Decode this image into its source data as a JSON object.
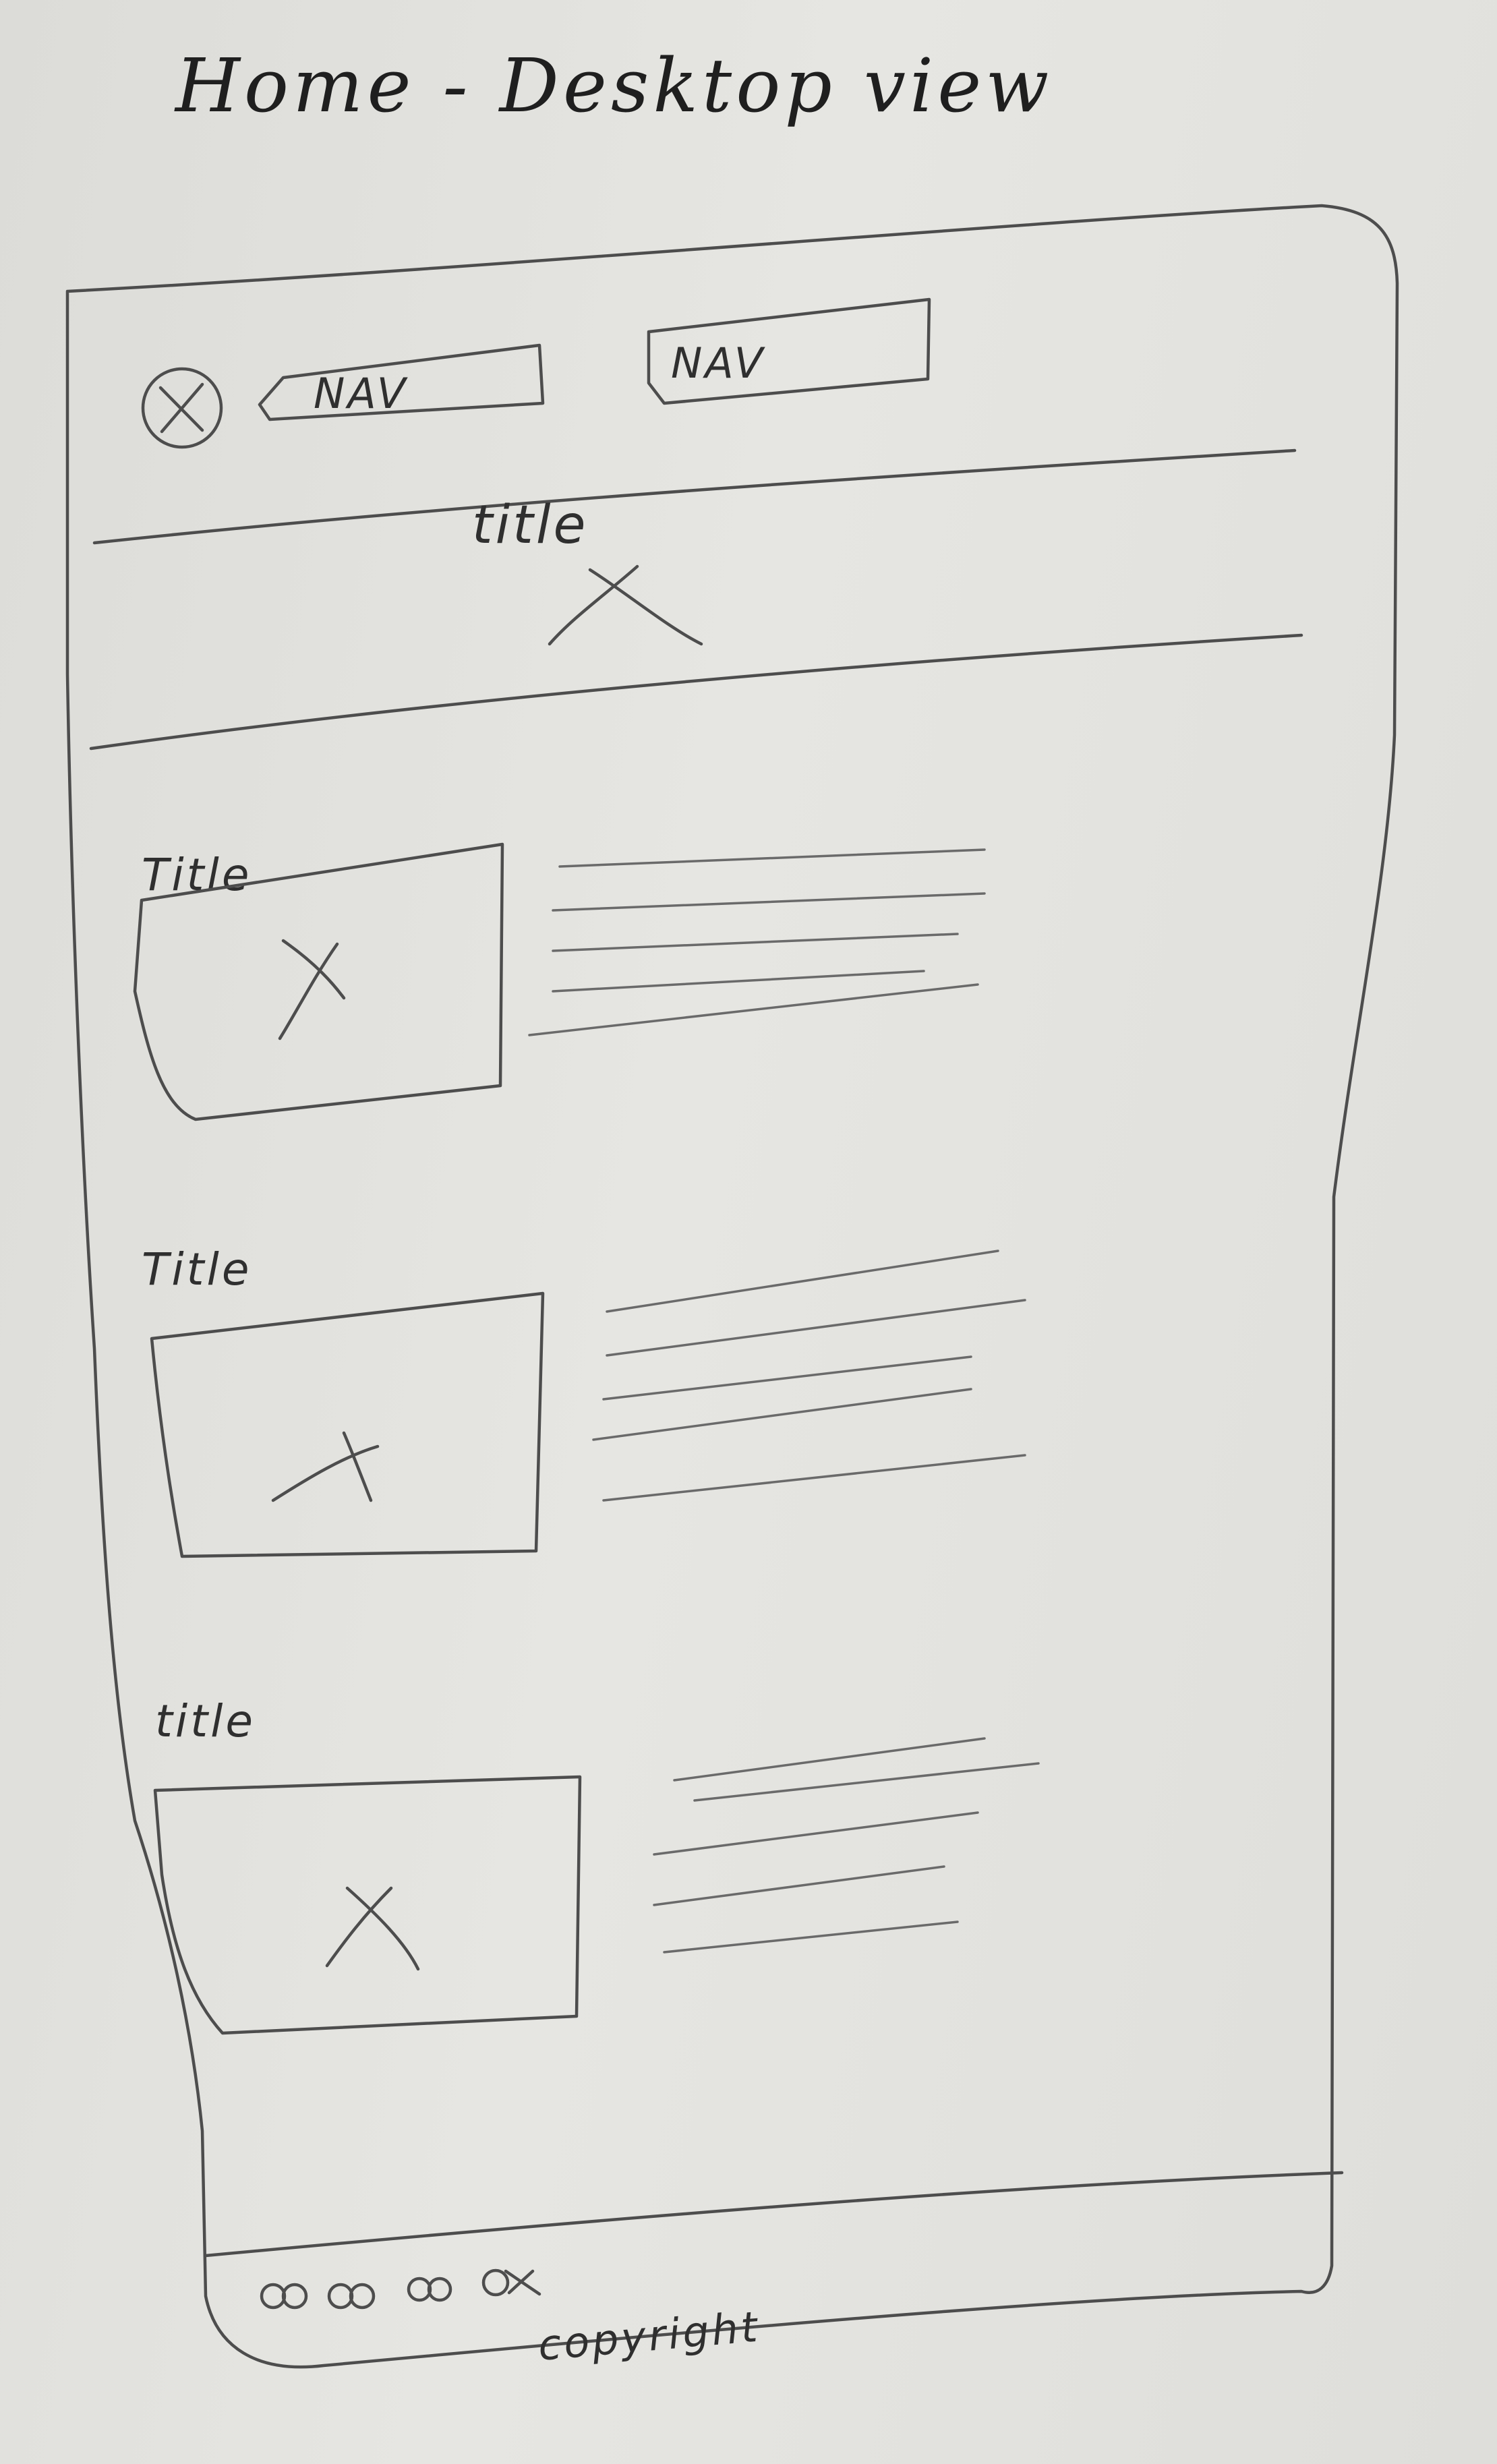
{
  "heading": "Home - Desktop view",
  "header": {
    "logo_mark": "X",
    "nav": [
      "NAV",
      "NAV"
    ]
  },
  "hero": {
    "title": "title",
    "image_mark": "X"
  },
  "sections": [
    {
      "title": "Title",
      "image_mark": "X"
    },
    {
      "title": "Title",
      "image_mark": "X"
    },
    {
      "title": "title",
      "image_mark": "X"
    }
  ],
  "footer": {
    "icons": [
      "social-icon",
      "social-icon",
      "social-icon",
      "social-icon"
    ],
    "copyright": "copyright"
  }
}
